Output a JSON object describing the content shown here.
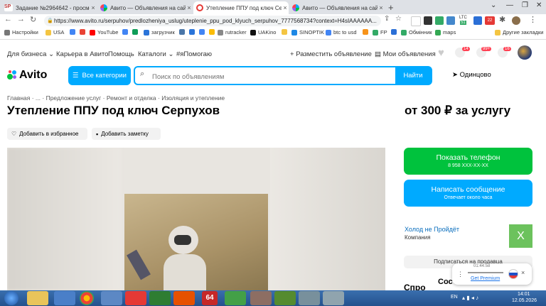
{
  "browser": {
    "tabs": [
      {
        "title": "Задание №2964642 - просмотр з",
        "favicon": "SP",
        "active": false
      },
      {
        "title": "Авито — Объявления на сайте А",
        "active": false
      },
      {
        "title": "Утепление ППУ под ключ Серпухо",
        "active": true
      },
      {
        "title": "Авито — Объявления на сайте А",
        "active": false
      }
    ],
    "new_tab": "+",
    "url": "https://www.avito.ru/serpuhov/predlozheniya_uslug/uteplenie_ppu_pod_klyuch_serpuhov_7777568734?context=H4sIAAAAAA...",
    "ext_badges": {
      "ltc": "LTC",
      "ltc_value": "51",
      "mail": "22"
    },
    "bookmarks": [
      "Настройки",
      "USA",
      "YouTube",
      "загрузчик",
      "rutracker",
      "UAKino",
      "SINOPTIK",
      "btc to usd",
      "FP",
      "Обмінник",
      "maps",
      "Другие закладки"
    ]
  },
  "avito": {
    "topnav": {
      "business": "Для бизнеса",
      "career": "Карьера в Авито",
      "help": "Помощь",
      "catalogs": "Каталоги",
      "tag": "#яПомогаю",
      "post_ad": "Разместить объявление",
      "my_ads": "Мои объявления",
      "badges": {
        "favorites": "14",
        "messages": "99+",
        "notifications": "16"
      }
    },
    "logo": "Avito",
    "categories_button": "Все категории",
    "search": {
      "placeholder": "Поиск по объявлениям",
      "button": "Найти"
    },
    "location": "Одинцово",
    "breadcrumb": [
      "Главная",
      "...",
      "Предложение услуг",
      "Ремонт и отделка",
      "Изоляция и утепление"
    ],
    "title": "Утепление ППУ под ключ Серпухов",
    "price": "от 300 ₽ за услугу",
    "actions": {
      "favorite": "Добавить в избранное",
      "note": "Добавить заметку"
    },
    "contact": {
      "call": "Показать телефон",
      "call_sub": "8 958 XXX-XX-XX",
      "message": "Написать сообщение",
      "message_sub": "Отвечает около часа"
    },
    "seller": {
      "name": "Холод не Пройдёт",
      "type": "Компания",
      "avatar_letter": "Х"
    },
    "subscribe": "Подписаться на продавца",
    "bottom_text": "Спро"
  },
  "popup": {
    "time": "01:44:58",
    "link": "Get Premium",
    "partial": "Сос"
  },
  "taskbar": {
    "lang": "EN",
    "time": "14:01",
    "date": "12.05.2026",
    "app_64": "64"
  },
  "colors": {
    "avito_blue": "#00aaff",
    "avito_green": "#00c23d",
    "seller_avatar": "#6cc25d"
  }
}
